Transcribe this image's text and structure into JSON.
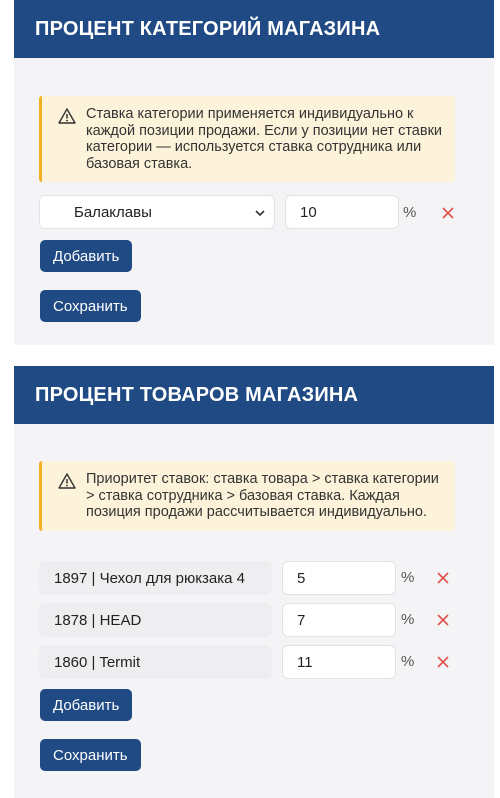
{
  "category_section": {
    "title": "ПРОЦЕНТ КАТЕГОРИЙ МАГАЗИНА",
    "note": "Ставка категории применяется индивидуально к каждой позиции продажи. Если у позиции нет ставки категории — используется ставка сотрудника или базовая ставка.",
    "rows": [
      {
        "category": "Балаклавы",
        "value": "10",
        "unit": "%"
      }
    ],
    "add_label": "Добавить",
    "save_label": "Сохранить"
  },
  "product_section": {
    "title": "ПРОЦЕНТ ТОВАРОВ МАГАЗИНА",
    "note": "Приоритет ставок: ставка товара > ставка категории > ставка сотрудника > базовая ставка. Каждая позиция продажи рассчитывается индивидуально.",
    "rows": [
      {
        "product": "1897 | Чехол для рюкзака 4",
        "value": "5",
        "unit": "%"
      },
      {
        "product": "1878 | HEAD",
        "value": "7",
        "unit": "%"
      },
      {
        "product": "1860 | Termit",
        "value": "11",
        "unit": "%"
      }
    ],
    "add_label": "Добавить",
    "save_label": "Сохранить"
  },
  "icons": {
    "warning": "warning-icon",
    "remove": "close-icon",
    "dropdown": "chevron-down-icon"
  },
  "colors": {
    "header_bg": "#1f4a84",
    "button_bg": "#1f4a84",
    "note_bg": "#fdf3da",
    "note_border": "#f3b020",
    "remove": "#e0514f",
    "panel_bg": "#f4f4f6"
  }
}
